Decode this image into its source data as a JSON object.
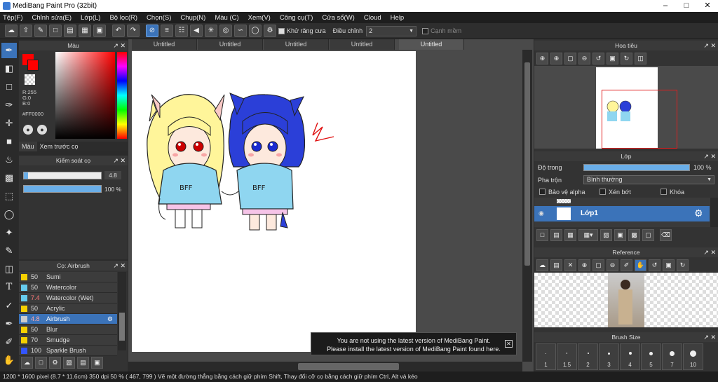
{
  "app": {
    "title": "MediBang Paint Pro (32bit)"
  },
  "menu": [
    "Tệp(F)",
    "Chỉnh sửa(E)",
    "Lớp(L)",
    "Bộ lọc(R)",
    "Chọn(S)",
    "Chụp(N)",
    "Màu (C)",
    "Xem(V)",
    "Công cụ(T)",
    "Cửa sổ(W)",
    "Cloud",
    "Help"
  ],
  "toolbar": {
    "antialias_label": "Khử răng cưa",
    "adjust_label": "Điều chỉnh",
    "adjust_value": "2",
    "edge_label": "Cạnh mềm"
  },
  "color_panel": {
    "title": "Màu",
    "r": "R:255",
    "g": "G:0",
    "b": "B:0",
    "hex": "#FF0000",
    "tab_color": "Màu",
    "tab_preview": "Xem trước cọ",
    "primary_color": "#ff0000"
  },
  "brush_control": {
    "title": "Kiểm soát cọ",
    "size_value": "4.8",
    "opacity_value": "100 %",
    "size_fraction": 0.05,
    "opacity_fraction": 1.0
  },
  "brush_list": {
    "title": "Cọ: Airbrush",
    "items": [
      {
        "size": "50",
        "name": "Sumi",
        "color": "#f5d000"
      },
      {
        "size": "50",
        "name": "Watercolor",
        "color": "#66ccee"
      },
      {
        "size": "7.4",
        "name": "Watercolor (Wet)",
        "color": "#66ccee"
      },
      {
        "size": "50",
        "name": "Acrylic",
        "color": "#f5d000"
      },
      {
        "size": "4.8",
        "name": "Airbrush",
        "color": "#cccccc"
      },
      {
        "size": "50",
        "name": "Blur",
        "color": "#f5d000"
      },
      {
        "size": "70",
        "name": "Smudge",
        "color": "#f5d000"
      },
      {
        "size": "100",
        "name": "Sparkle Brush",
        "color": "#3355ff"
      }
    ]
  },
  "tabs": [
    "Untitled",
    "Untitled",
    "Untitled",
    "Untitled",
    "Untitled"
  ],
  "navigator": {
    "title": "Hoa tiêu"
  },
  "layer_panel": {
    "title": "Lớp",
    "opacity_label": "Độ trong",
    "opacity_value": "100 %",
    "blend_label": "Pha trộn",
    "blend_value": "Bình thường",
    "protect_alpha": "Bảo vệ alpha",
    "clipping": "Xén bớt",
    "lock": "Khóa",
    "layer_name": "Lớp1",
    "opacity_fraction": 1.0
  },
  "reference": {
    "title": "Reference"
  },
  "brush_size": {
    "title": "Brush Size",
    "sizes": [
      "1",
      "1.5",
      "2",
      "3",
      "4",
      "5",
      "7",
      "10"
    ]
  },
  "notice": {
    "line1": "You are not using the latest version of MediBang Paint.",
    "line2": "Please install the latest version of MediBang Paint found here."
  },
  "status": {
    "text": "1200 * 1600 pixel   (8.7 * 11.6cm)   350 dpi   50 %   ( 467, 799 )   Vẽ một đường thẳng bằng cách giữ phím Shift, Thay đổi cỡ cọ bằng cách giữ phím Ctrl, Alt và kéo"
  }
}
